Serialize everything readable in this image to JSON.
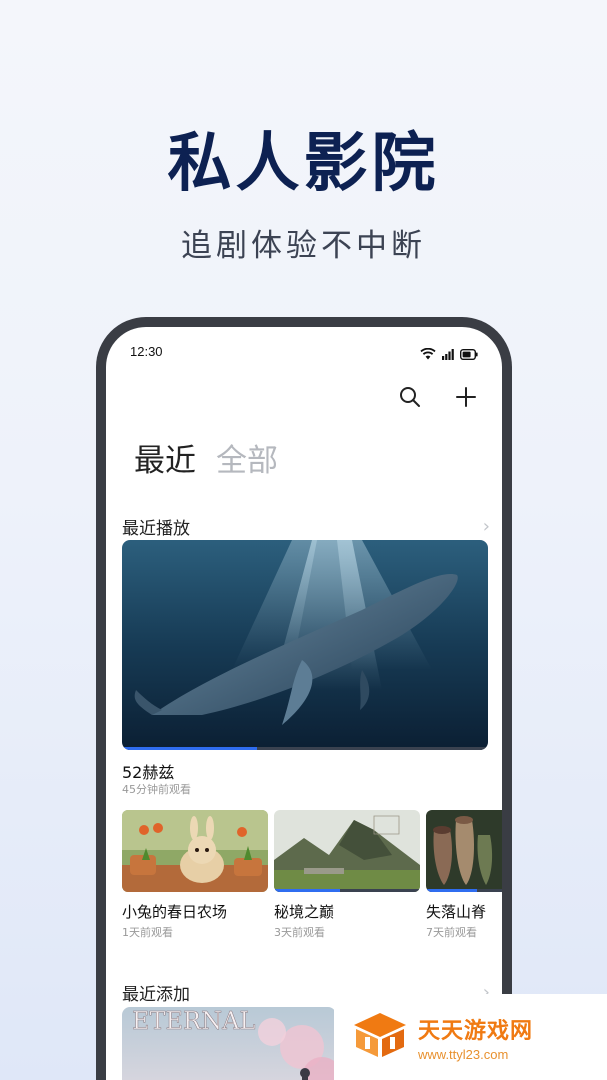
{
  "hero": {
    "title": "私人影院",
    "subtitle": "追剧体验不中断"
  },
  "status_bar": {
    "time": "12:30",
    "icons": [
      "wifi-icon",
      "signal-icon",
      "battery-icon"
    ]
  },
  "toolbar": {
    "icons": [
      "search-icon",
      "plus-icon"
    ]
  },
  "tabs": [
    {
      "label": "最近",
      "active": true
    },
    {
      "label": "全部",
      "active": false
    }
  ],
  "recent_play": {
    "section_title": "最近播放",
    "featured": {
      "title": "52赫兹",
      "meta": "45分钟前观看",
      "progress": 0.37
    },
    "items": [
      {
        "title": "小兔的春日农场",
        "meta": "1天前观看",
        "progress": 0.0
      },
      {
        "title": "秘境之巅",
        "meta": "3天前观看",
        "progress": 0.45
      },
      {
        "title": "失落山脊",
        "meta": "7天前观看",
        "progress": 0.35
      }
    ]
  },
  "recent_added": {
    "section_title": "最近添加",
    "first_item_art_text": "ETERNAL"
  },
  "watermark": {
    "name": "天天游戏网",
    "url": "www.ttyl23.com"
  },
  "colors": {
    "title": "#0d2152",
    "accent": "#2f6df0",
    "watermark": "#f07a12"
  }
}
